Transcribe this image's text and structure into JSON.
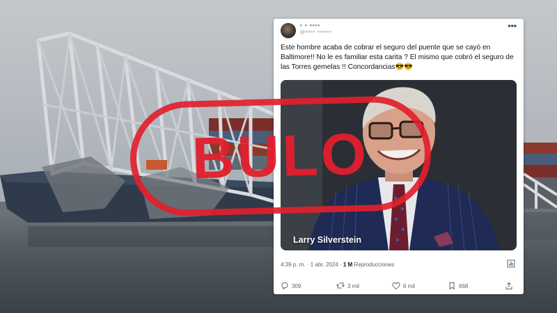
{
  "tweet": {
    "author": {
      "name": "• • ••••",
      "handle": "@•••• ••••••"
    },
    "more_icon": "•••",
    "text": "Este hombre acaba de cobrar el seguro del puente que se cayó en Baltimore!! No le es familiar esta carita ? El mismo que cobró el seguro de las Torres gemelas !! Concordancias😎😎",
    "image_caption": "Larry Silverstein",
    "time": "4:39 p. m.",
    "date": "1 abr. 2024",
    "views": "1 M",
    "views_label": "Reproducciones",
    "separator": "·",
    "replies": "309",
    "retweets": "3 mil",
    "likes": "6 mil",
    "bookmarks": "668"
  },
  "stamp": {
    "label": "BULO",
    "color": "#e21f2d"
  },
  "icons": {
    "reply": "reply-icon",
    "retweet": "retweet-icon",
    "like": "heart-icon",
    "bookmark": "bookmark-icon",
    "share": "share-icon",
    "stats": "stats-icon"
  }
}
